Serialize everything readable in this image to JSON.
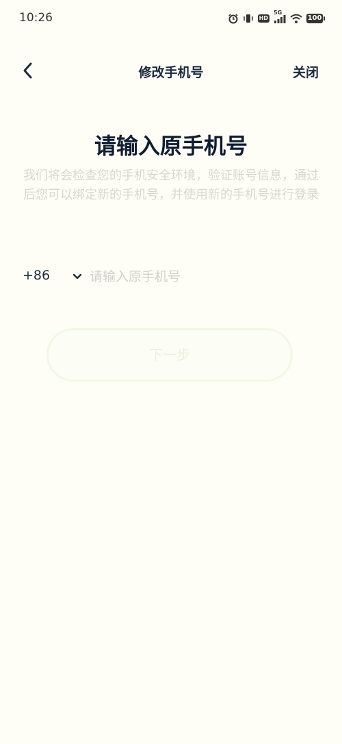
{
  "status_bar": {
    "time": "10:26",
    "hd_label": "HD",
    "network_label": "5G",
    "battery": "100"
  },
  "nav": {
    "title": "修改手机号",
    "close_label": "关闭",
    "back_icon": "chevron-left-icon"
  },
  "main": {
    "heading": "请输入原手机号",
    "description": "我们将会检查您的手机安全环境，验证账号信息，通过后您可以绑定新的手机号，并使用新的手机号进行登录"
  },
  "phone_form": {
    "country_code": "+86",
    "dropdown_icon": "chevron-down-icon",
    "placeholder": "请输入原手机号",
    "value": ""
  },
  "next_button": {
    "label": "下一步"
  },
  "colors": {
    "background": "#fefef6",
    "text_primary": "#1c2a3f",
    "text_muted": "#d6d7d2",
    "button_disabled_border": "#f0f8e6"
  }
}
